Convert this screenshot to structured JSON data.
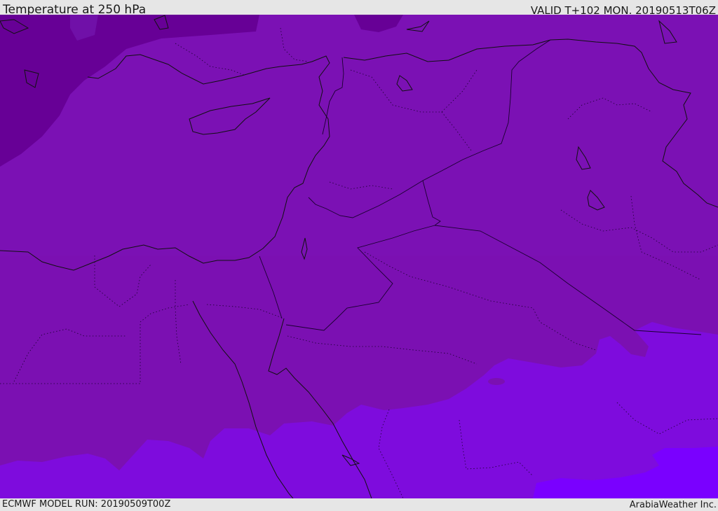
{
  "header": {
    "title": "Temperature at 250 hPa",
    "valid": "VALID T+102 MON. 20190513T06Z"
  },
  "footer": {
    "model_run": "ECMWF MODEL RUN: 20190509T00Z",
    "credit": "ArabiaWeather Inc."
  },
  "map": {
    "colors": {
      "cold_band": "#670096",
      "base_band": "#7b10b2",
      "mid_band": "#7e0cdd",
      "warm_band": "#7a00ff",
      "coastline": "#111111",
      "border": "#2a0a40"
    }
  }
}
